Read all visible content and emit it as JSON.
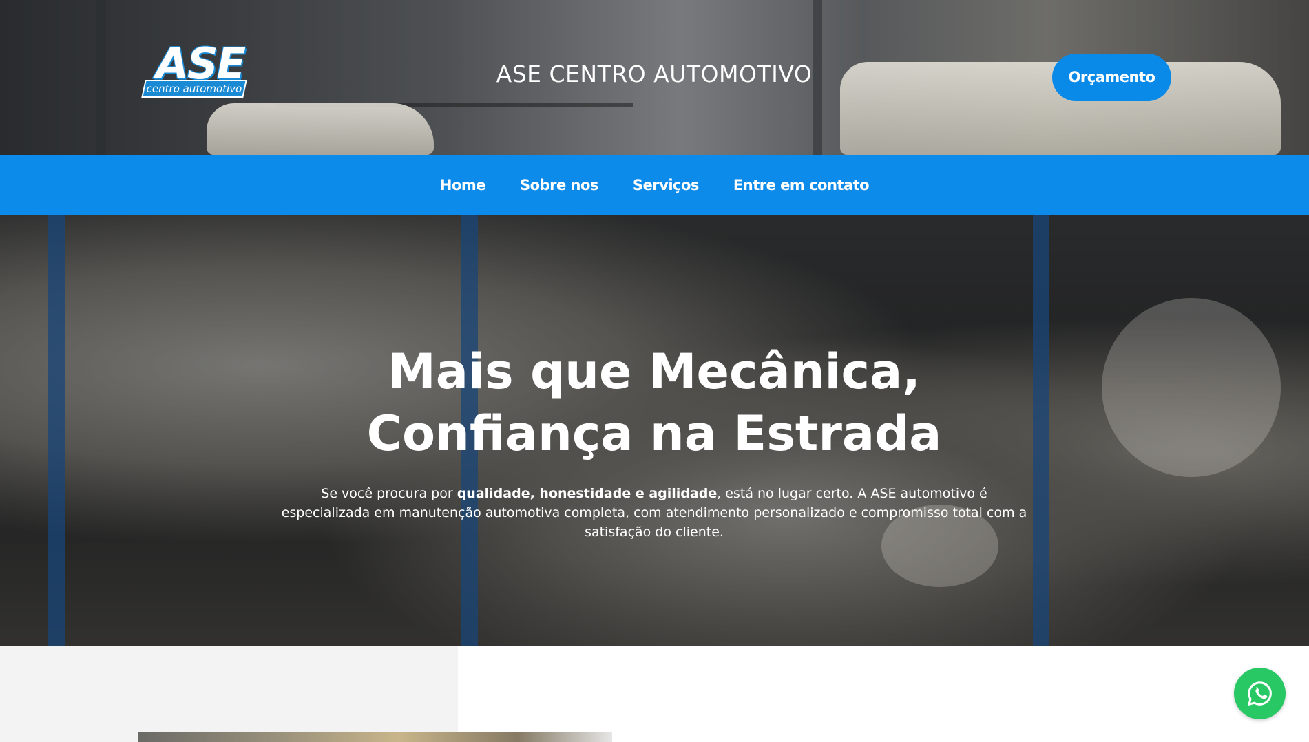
{
  "header": {
    "logo": {
      "wordmark": "ASE",
      "tagline": "centro automotivo"
    },
    "site_title": "ASE CENTRO AUTOMOTIVO",
    "cta_label": "Orçamento"
  },
  "nav": {
    "items": [
      {
        "label": "Home"
      },
      {
        "label": "Sobre nos"
      },
      {
        "label": "Serviços"
      },
      {
        "label": "Entre em contato"
      }
    ]
  },
  "hero": {
    "title_line1": "Mais que Mecânica,",
    "title_line2": "Confiança na Estrada",
    "text_prefix": "Se você procura por ",
    "text_bold": "qualidade, honestidade e agilidade",
    "text_suffix": ", está no lugar certo. A ASE automotivo é especializada em manutenção automotiva completa, com atendimento personalizado e compromisso total com a satisfação do cliente."
  },
  "floating": {
    "whatsapp_icon": "whatsapp-icon"
  },
  "colors": {
    "brand_blue": "#0d8bea",
    "whatsapp_green": "#28c864",
    "text_white": "#ffffff"
  }
}
